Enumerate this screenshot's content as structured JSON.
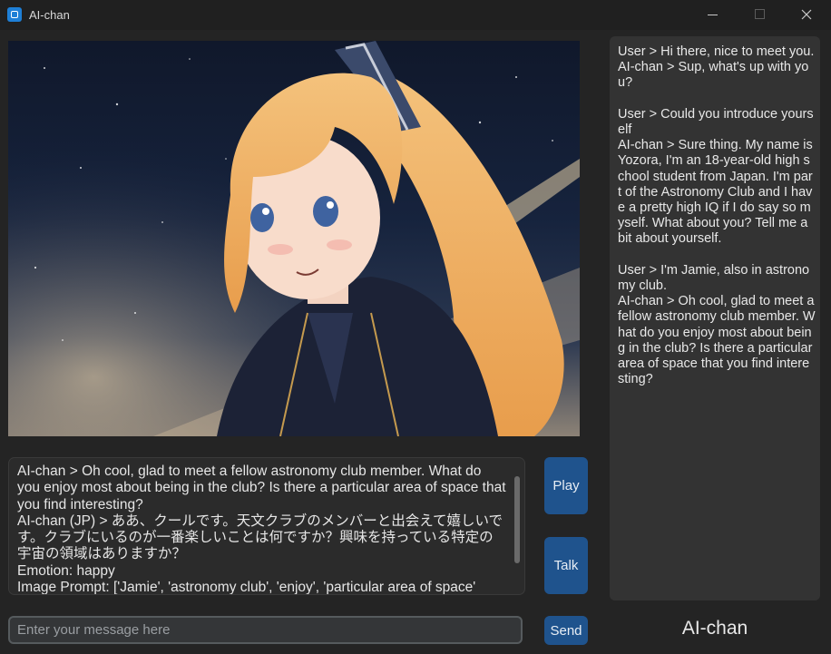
{
  "window": {
    "title": "AI-chan",
    "icon": "app-icon"
  },
  "output": {
    "text": "AI-chan > Oh cool, glad to meet a fellow astronomy club member. What do you enjoy most about being in the club? Is there a particular area of space that you find interesting?\nAI-chan (JP) > ああ、クールです。天文クラブのメンバーと出会えて嬉しいです。クラブにいるのが一番楽しいことは何ですか？興味を持っている特定の宇宙の領域はありますか？\nEmotion: happy\nImage Prompt: ['Jamie', 'astronomy club', 'enjoy', 'particular area of space'"
  },
  "buttons": {
    "play": "Play",
    "talk": "Talk",
    "send": "Send"
  },
  "input": {
    "placeholder": "Enter your message here",
    "value": ""
  },
  "chat": {
    "text": "User > Hi there, nice to meet you.\nAI-chan > Sup, what's up with you?\n\nUser > Could you introduce yourself\nAI-chan > Sure thing. My name is Yozora, I'm an 18-year-old high school student from Japan. I'm part of the Astronomy Club and I have a pretty high IQ if I do say so myself. What about you? Tell me a bit about yourself.\n\nUser > I'm Jamie, also in astronomy club.\nAI-chan > Oh cool, glad to meet a fellow astronomy club member. What do you enjoy most about being in the club? Is there a particular area of space that you find interesting?"
  },
  "character": {
    "name": "AI-chan"
  }
}
